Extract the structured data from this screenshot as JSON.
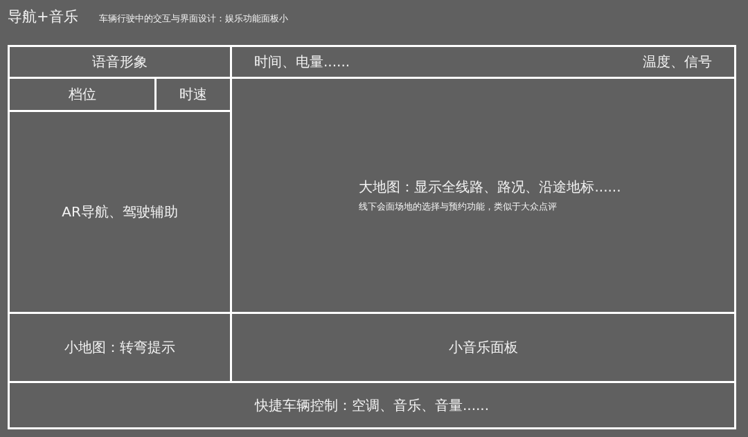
{
  "header": {
    "title": "导航+音乐",
    "subtitle": "车辆行驶中的交互与界面设计：娱乐功能面板小"
  },
  "wireframe": {
    "voice_avatar": "语音形象",
    "status_left": "时间、电量......",
    "status_right": "温度、信号",
    "gear": "档位",
    "speed": "时速",
    "ar_navigation": "AR导航、驾驶辅助",
    "big_map": {
      "title": "大地图：显示全线路、路况、沿途地标......",
      "note": "线下会面场地的选择与预约功能，类似于大众点评"
    },
    "mini_map": "小地图：转弯提示",
    "music_panel": "小音乐面板",
    "quick_controls": "快捷车辆控制：空调、音乐、音量......"
  }
}
